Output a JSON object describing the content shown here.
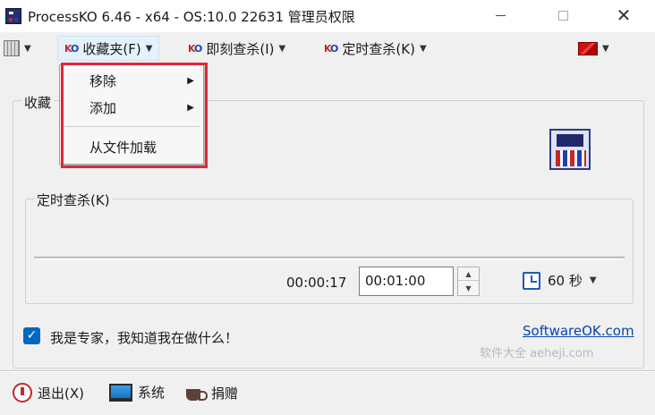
{
  "window": {
    "title": "ProcessKO 6.46 - x64  - OS:10.0 22631 管理员权限",
    "minimize_glyph": "",
    "close_glyph": "✕"
  },
  "toolbar": {
    "favorites_label": "收藏夹(F)",
    "kill_now_label": "即刻查杀(I)",
    "timed_kill_label": "定时查杀(K)",
    "caret": "▼"
  },
  "menu": {
    "remove": "移除",
    "add": "添加",
    "load_from_file": "从文件加载",
    "submenu_arrow": "▶"
  },
  "favorites_group": {
    "label": "收藏"
  },
  "timer_group": {
    "label": "定时查杀(K)",
    "elapsed": "00:00:17",
    "countdown_value": "00:01:00",
    "interval_value": "60 秒"
  },
  "options": {
    "expert_checked": true,
    "expert_label": "我是专家，我知道我在做什么！",
    "check_glyph": "✓"
  },
  "links": {
    "softwareok": "SoftwareOK.com"
  },
  "watermark": "软件大全 aeheji.com",
  "statusbar": {
    "exit_label": "退出(X)",
    "system_label": "系统",
    "donate_label": "捐赠"
  },
  "colors": {
    "accent": "#0067c0",
    "highlight_frame": "#e0263a",
    "link": "#0645ad"
  },
  "icons": {
    "app": "processko-app-icon",
    "grid": "grid-view-icon",
    "flag": "flag-icon",
    "clock": "clock-icon",
    "power": "power-icon",
    "monitor": "monitor-icon",
    "coffee": "coffee-icon"
  }
}
